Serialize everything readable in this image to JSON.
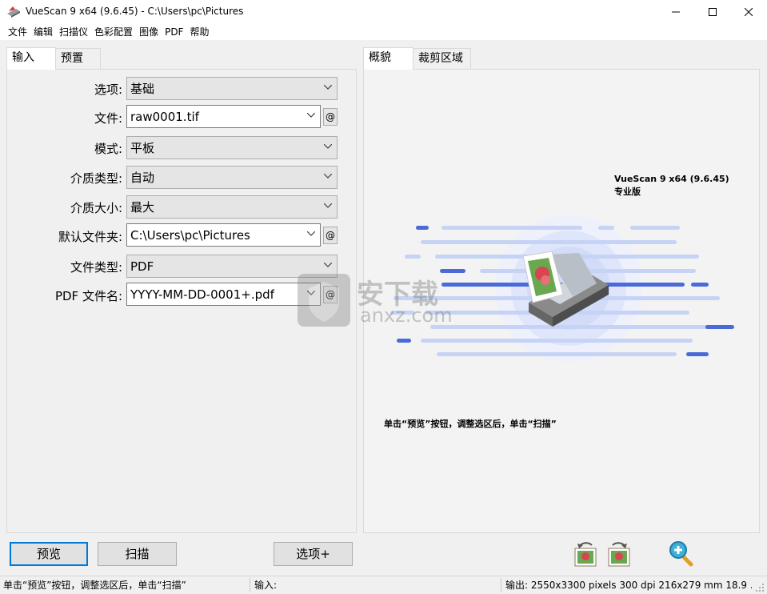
{
  "window": {
    "title": "VueScan 9 x64 (9.6.45) - C:\\Users\\pc\\Pictures",
    "minimize_icon": "minimize-icon",
    "maximize_icon": "maximize-icon",
    "close_icon": "close-icon"
  },
  "menu": [
    "文件",
    "编辑",
    "扫描仪",
    "色彩配置",
    "图像",
    "PDF",
    "帮助"
  ],
  "left_tabs": [
    "输入",
    "预置"
  ],
  "right_tabs": [
    "概貌",
    "裁剪区域"
  ],
  "form": {
    "options_label": "选项:",
    "options_value": "基础",
    "file_label": "文件:",
    "file_value": "raw0001.tif",
    "file_at": "@",
    "mode_label": "模式:",
    "mode_value": "平板",
    "media_type_label": "介质类型:",
    "media_type_value": "自动",
    "media_size_label": "介质大小:",
    "media_size_value": "最大",
    "default_folder_label": "默认文件夹:",
    "default_folder_value": "C:\\Users\\pc\\Pictures",
    "folder_at": "@",
    "file_type_label": "文件类型:",
    "file_type_value": "PDF",
    "pdf_name_label": "PDF 文件名:",
    "pdf_name_value": "YYYY-MM-DD-0001+.pdf",
    "pdf_at": "@"
  },
  "preview": {
    "version_line1": "VueScan 9 x64 (9.6.45)",
    "version_line2": "专业版",
    "hint": "单击“预览”按钮，调整选区后，单击“扫描”",
    "watermark_cn": "安下载",
    "watermark_en": "anxz.com"
  },
  "buttons": {
    "preview": "预览",
    "scan": "扫描",
    "options_plus": "选项+"
  },
  "toolbar_icons": [
    "rotate-left-icon",
    "rotate-right-icon",
    "zoom-in-icon"
  ],
  "status": {
    "left": "单击“预览”按钮，调整选区后，单击“扫描”",
    "input": "输入:",
    "output": "输出: 2550x3300 pixels 300 dpi 216x279 mm 18.9 ..."
  },
  "colors": {
    "accent": "#0078d7",
    "stripe": "#4a6ad8",
    "stripe_light": "#c6d3f5",
    "glow": "#dfe6fb"
  }
}
